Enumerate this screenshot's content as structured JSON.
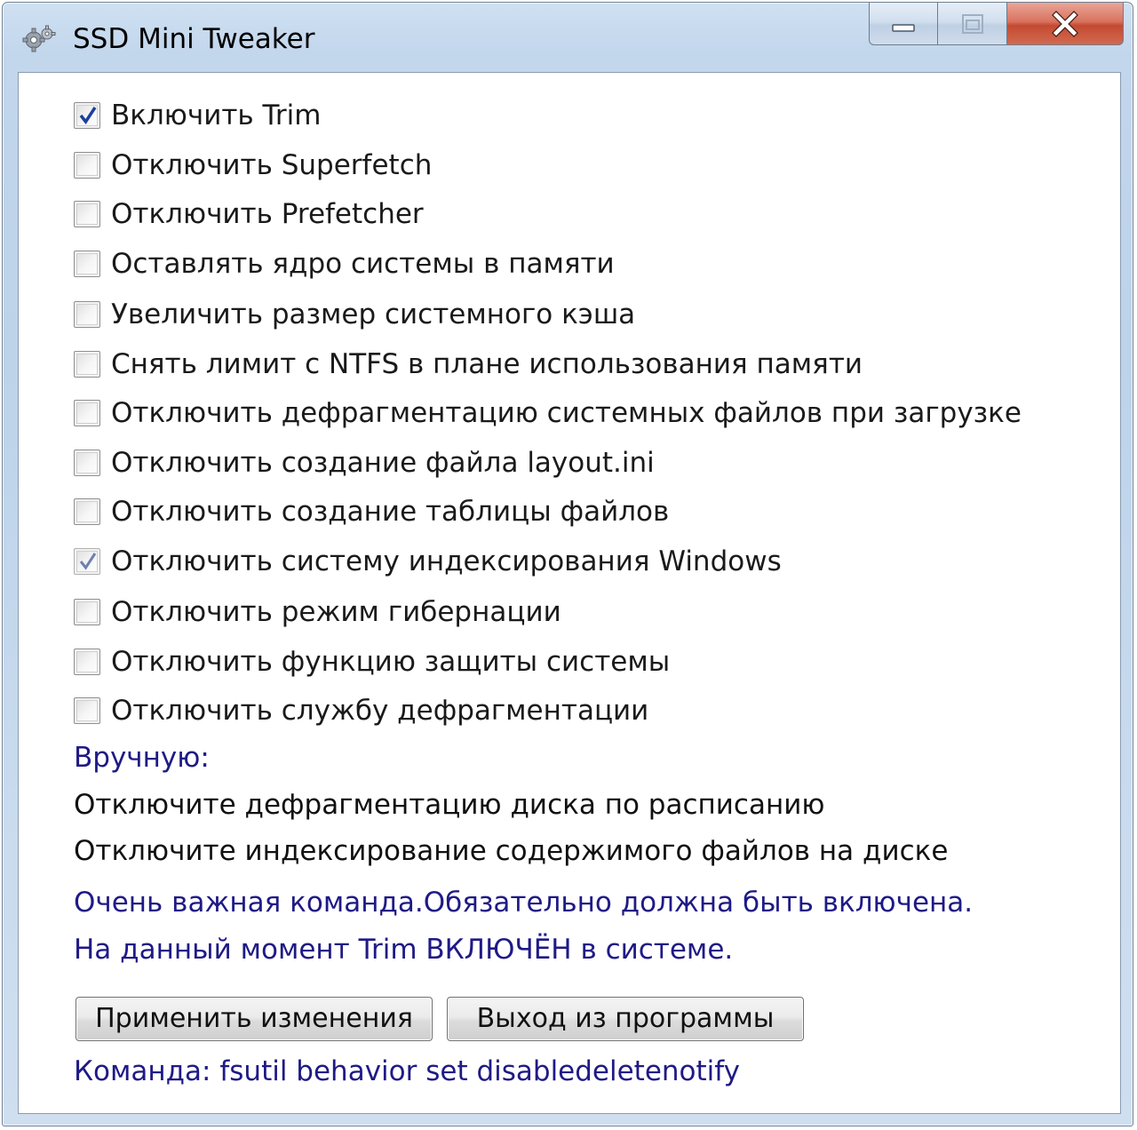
{
  "window": {
    "title": "SSD Mini Tweaker",
    "icon": "gear-icon"
  },
  "options": [
    {
      "label": "Включить Trim",
      "checked": true
    },
    {
      "label": "Отключить Superfetch",
      "checked": false
    },
    {
      "label": "Отключить Prefetcher",
      "checked": false
    },
    {
      "label": "Оставлять ядро системы в памяти",
      "checked": false
    },
    {
      "label": "Увеличить размер системного кэша",
      "checked": false
    },
    {
      "label": "Снять лимит с NTFS в плане использования памяти",
      "checked": false
    },
    {
      "label": "Отключить дефрагментацию системных файлов при загрузке",
      "checked": false
    },
    {
      "label": "Отключить создание файла layout.ini",
      "checked": false
    },
    {
      "label": "Отключить создание таблицы файлов",
      "checked": false
    },
    {
      "label": "Отключить систему индексирования Windows",
      "checked": true,
      "disabled": true
    },
    {
      "label": "Отключить режим гибернации",
      "checked": false
    },
    {
      "label": "Отключить функцию защиты системы",
      "checked": false
    },
    {
      "label": "Отключить службу дефрагментации",
      "checked": false
    }
  ],
  "manual": {
    "heading": "Вручную:",
    "line1": "Отключите дефрагментацию диска по расписанию",
    "line2": "Отключите индексирование содержимого файлов на диске"
  },
  "info": {
    "line1": "Очень важная команда.Обязательно должна быть включена.",
    "line2": "На данный момент Trim ВКЛЮЧЁН в системе."
  },
  "buttons": {
    "apply": "Применить изменения",
    "exit": "Выход из программы"
  },
  "command": "Команда: fsutil behavior set disabledeletenotify",
  "colors": {
    "info_text": "#1f1a86",
    "check_active": "#1c3f9c",
    "check_disabled": "#6f7fae"
  }
}
